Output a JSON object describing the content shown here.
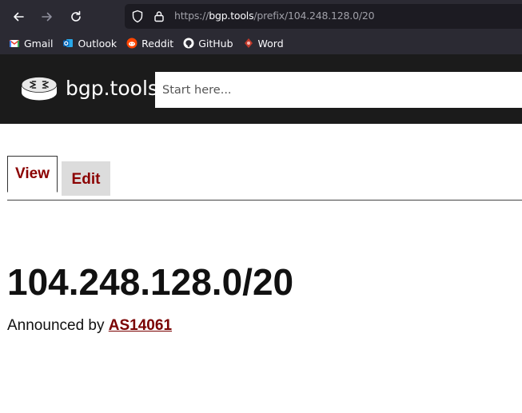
{
  "browser": {
    "url_scheme": "https://",
    "url_host": "bgp.tools",
    "url_path": "/prefix/104.248.128.0/20",
    "bookmarks": [
      {
        "label": "Gmail",
        "icon": "gmail-icon"
      },
      {
        "label": "Outlook",
        "icon": "outlook-icon"
      },
      {
        "label": "Reddit",
        "icon": "reddit-icon"
      },
      {
        "label": "GitHub",
        "icon": "github-icon"
      },
      {
        "label": "Word",
        "icon": "word-icon"
      }
    ]
  },
  "site": {
    "brand": "bgp.tools",
    "search_placeholder": "Start here..."
  },
  "tabs": {
    "view": "View",
    "edit": "Edit"
  },
  "prefix": {
    "title": "104.248.128.0/20",
    "announced_label": "Announced by",
    "asn": "AS14061"
  },
  "colors": {
    "chrome_bg": "#2b2a33",
    "header_bg": "#1b1b1b",
    "tab_text": "#8b0000",
    "link": "#7a0000"
  }
}
